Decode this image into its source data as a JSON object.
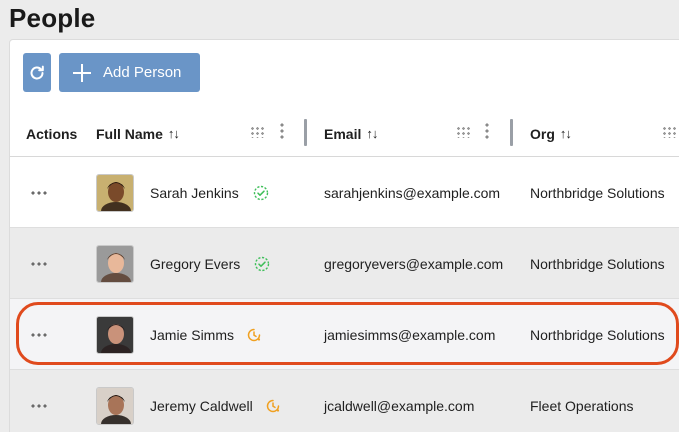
{
  "page": {
    "title": "People"
  },
  "toolbar": {
    "add_label": "Add Person"
  },
  "table": {
    "columns": {
      "actions": "Actions",
      "full_name": "Full Name",
      "email": "Email",
      "org": "Org",
      "sort_glyph": "↑↓"
    },
    "rows": [
      {
        "name": "Sarah Jenkins",
        "email": "sarahjenkins@example.com",
        "org": "Northbridge Solutions",
        "status": "verified",
        "avatar": {
          "skin": "#7a4a2a",
          "hair": "#2a1a10",
          "bg": "#c8b070"
        }
      },
      {
        "name": "Gregory Evers",
        "email": "gregoryevers@example.com",
        "org": "Northbridge Solutions",
        "status": "verified",
        "avatar": {
          "skin": "#e8b89a",
          "hair": "#5a4030",
          "bg": "#9a9a9a"
        }
      },
      {
        "name": "Jamie Simms",
        "email": "jamiesimms@example.com",
        "org": "Northbridge Solutions",
        "status": "pending",
        "avatar": {
          "skin": "#c9927a",
          "hair": "#2a2020",
          "bg": "#3a3a3a"
        }
      },
      {
        "name": "Jeremy Caldwell",
        "email": "jcaldwell@example.com",
        "org": "Fleet Operations",
        "status": "pending",
        "avatar": {
          "skin": "#a87458",
          "hair": "#1a1410",
          "bg": "#d8d0c8"
        }
      }
    ]
  },
  "colors": {
    "accent": "#6a95c7",
    "verified": "#3fbf5a",
    "pending": "#f0a020",
    "highlight": "#e04a1d"
  },
  "icons": {
    "refresh": "refresh-icon",
    "add": "plus-icon",
    "verified": "verified-badge-icon",
    "pending": "pending-clock-icon"
  }
}
